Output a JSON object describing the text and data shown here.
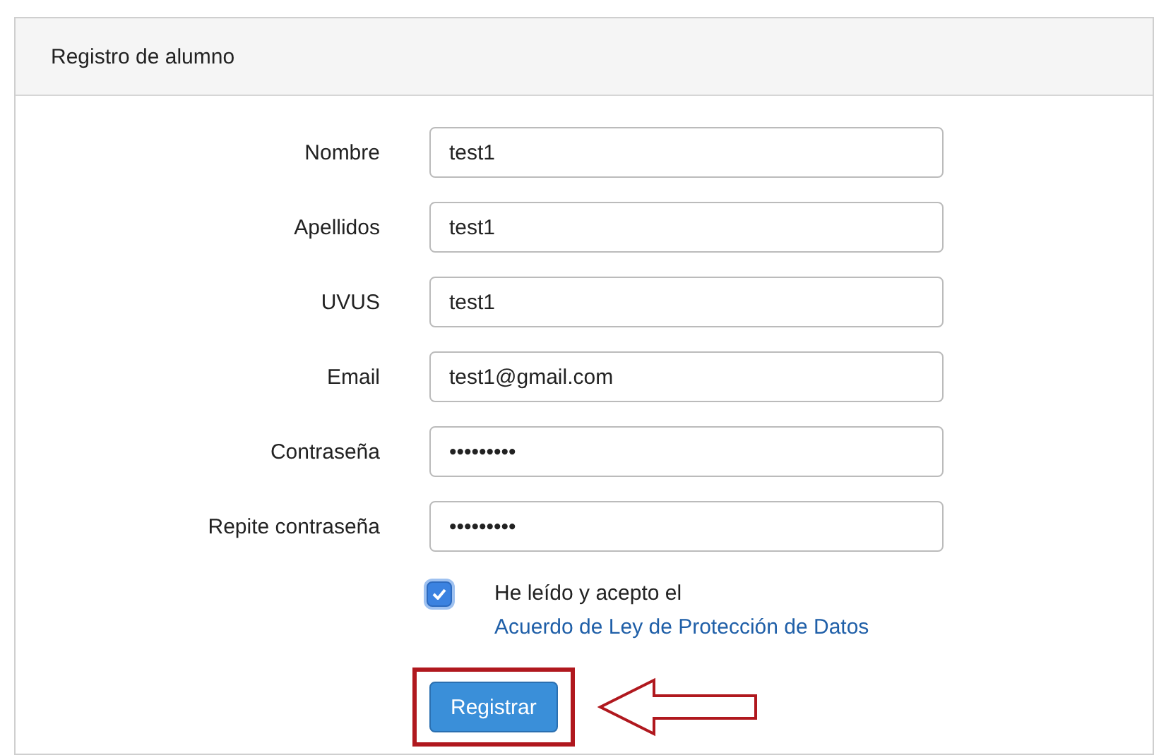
{
  "panel": {
    "title": "Registro de alumno"
  },
  "fields": [
    {
      "label": "Nombre",
      "value": "test1"
    },
    {
      "label": "Apellidos",
      "value": "test1"
    },
    {
      "label": "UVUS",
      "value": "test1"
    },
    {
      "label": "Email",
      "value": "test1@gmail.com"
    },
    {
      "label": "Contraseña",
      "value": "•••••••••"
    },
    {
      "label": "Repite contraseña",
      "value": "•••••••••"
    }
  ],
  "agreement": {
    "checked": true,
    "text": "He leído y acepto el",
    "link": "Acuerdo de Ley de Protección de Datos"
  },
  "submit": {
    "label": "Registrar",
    "highlighted": true
  }
}
